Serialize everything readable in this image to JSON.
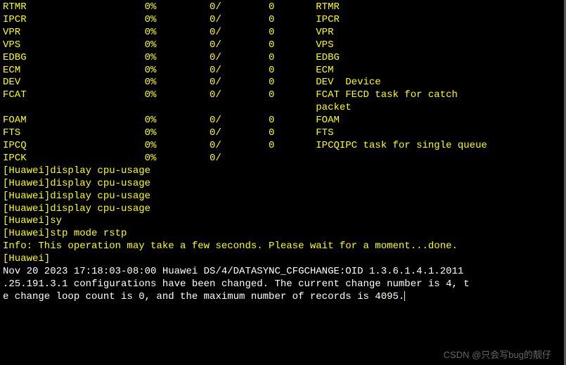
{
  "rows": [
    {
      "name": "RTMR",
      "pct": "0%",
      "slash": "0/",
      "zero": "0",
      "desc": "RTMR"
    },
    {
      "name": "IPCR",
      "pct": "0%",
      "slash": "0/",
      "zero": "0",
      "desc": "IPCR"
    },
    {
      "name": "VPR",
      "pct": "0%",
      "slash": "0/",
      "zero": "0",
      "desc": "VPR"
    },
    {
      "name": "VPS",
      "pct": "0%",
      "slash": "0/",
      "zero": "0",
      "desc": "VPS"
    },
    {
      "name": "EDBG",
      "pct": "0%",
      "slash": "0/",
      "zero": "0",
      "desc": "EDBG"
    },
    {
      "name": "ECM",
      "pct": "0%",
      "slash": "0/",
      "zero": "0",
      "desc": "ECM"
    },
    {
      "name": "DEV",
      "pct": "0%",
      "slash": "0/",
      "zero": "0",
      "desc": "DEV  Device"
    },
    {
      "name": "FCAT",
      "pct": "0%",
      "slash": "0/",
      "zero": "0",
      "desc": "FCAT FECD task for catch"
    },
    {
      "name": "",
      "pct": "",
      "slash": "",
      "zero": "",
      "desc": "packet"
    },
    {
      "name": "FOAM",
      "pct": "0%",
      "slash": "0/",
      "zero": "0",
      "desc": "FOAM"
    },
    {
      "name": "FTS",
      "pct": "0%",
      "slash": "0/",
      "zero": "0",
      "desc": "FTS"
    },
    {
      "name": "IPCQ",
      "pct": "0%",
      "slash": "0/",
      "zero": "0",
      "desc": "IPCQIPC task for single queue"
    },
    {
      "name": "IPCK",
      "pct": "0%",
      "slash": "0/",
      "zero": "",
      "desc": ""
    }
  ],
  "commands": {
    "c1": "[Huawei]display cpu-usage",
    "c2": "[Huawei]display cpu-usage",
    "c3": "[Huawei]display cpu-usage",
    "c4": "[Huawei]display cpu-usage",
    "c5": "[Huawei]sy",
    "c6": "[Huawei]stp mode rstp",
    "info": "Info: This operation may take a few seconds. Please wait for a moment...done.",
    "prompt": "[Huawei]"
  },
  "log": {
    "l1": "Nov 20 2023 17:18:03-08:00 Huawei DS/4/DATASYNC_CFGCHANGE:OID 1.3.6.1.4.1.2011",
    "l2": ".25.191.3.1 configurations have been changed. The current change number is 4, t",
    "l3": "e change loop count is 0, and the maximum number of records is 4095."
  },
  "watermark": "CSDN @只会写bug的靓仔"
}
